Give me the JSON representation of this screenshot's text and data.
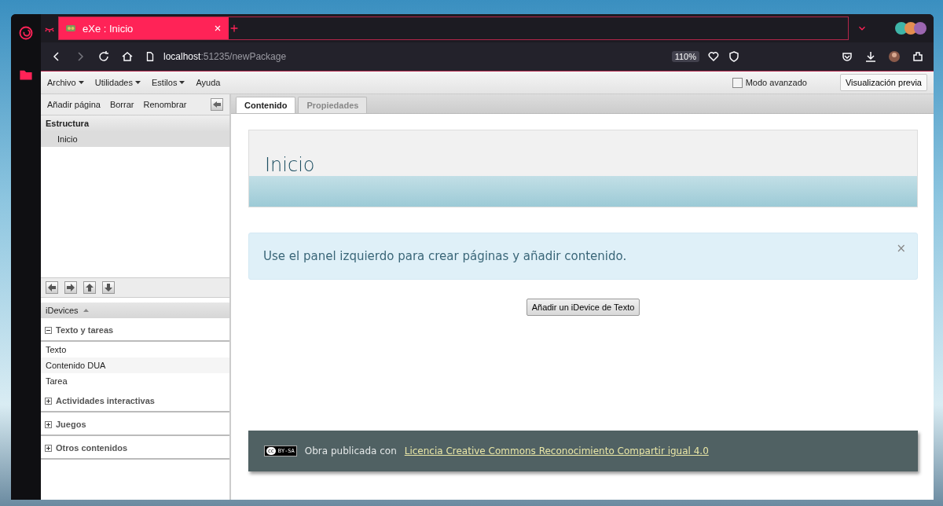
{
  "browser": {
    "tabs": [
      {
        "title": "eXe : Inicio",
        "selected": true
      }
    ],
    "url_host": "localhost",
    "url_path": ":51235/newPackage",
    "zoom": "110%"
  },
  "menu": [
    {
      "label": "Archivo",
      "dropdown": true
    },
    {
      "label": "Utilidades",
      "dropdown": true
    },
    {
      "label": "Estilos",
      "dropdown": true
    },
    {
      "label": "Ayuda",
      "dropdown": false
    }
  ],
  "advanced_mode": {
    "label": "Modo avanzado",
    "checked": false
  },
  "preview_button": "Visualización previa",
  "outline": {
    "toolbar": [
      "Añadir página",
      "Borrar",
      "Renombrar"
    ],
    "heading": "Estructura",
    "pages": [
      {
        "title": "Inicio",
        "selected": true
      }
    ]
  },
  "idevices": {
    "heading": "iDevices",
    "groups": [
      {
        "title": "Texto y tareas",
        "expanded": true,
        "items": [
          "Texto",
          "Contenido DUA",
          "Tarea"
        ]
      },
      {
        "title": "Actividades interactivas",
        "expanded": false
      },
      {
        "title": "Juegos",
        "expanded": false
      },
      {
        "title": "Otros contenidos",
        "expanded": false
      }
    ]
  },
  "content_tabs": [
    {
      "label": "Contenido",
      "selected": true
    },
    {
      "label": "Propiedades",
      "selected": false
    }
  ],
  "page": {
    "title": "Inicio",
    "alert": "Use el panel izquierdo para crear páginas y añadir contenido.",
    "alert_close": "×",
    "add_button": "Añadir un iDevice de Texto",
    "footer": {
      "badge_mark": "cc",
      "badge": "BY-SA",
      "text": "Obra publicada con",
      "link": "Licencia Creative Commons Reconocimiento Compartir igual 4.0"
    }
  }
}
